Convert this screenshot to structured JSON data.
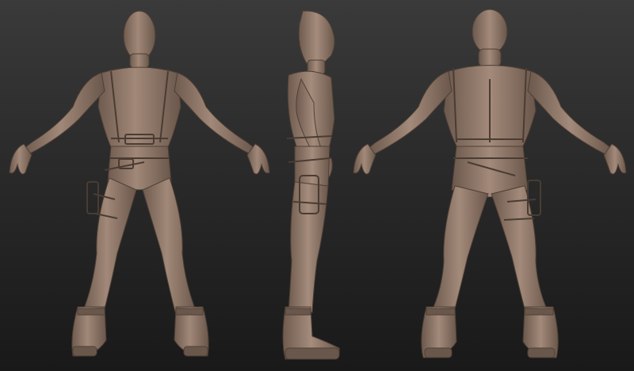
{
  "scene": {
    "subject": "",
    "views": [
      {
        "id": "front",
        "icon": "sculpt-figure-front-icon"
      },
      {
        "id": "side",
        "icon": "sculpt-figure-side-icon"
      },
      {
        "id": "back",
        "icon": "sculpt-figure-back-icon"
      }
    ],
    "colors": {
      "background_top": "#3a3a3a",
      "background_bottom": "#191919",
      "clay": "#8c7566",
      "clay_highlight": "#a38b7b",
      "clay_shadow": "#5b4a40"
    }
  }
}
